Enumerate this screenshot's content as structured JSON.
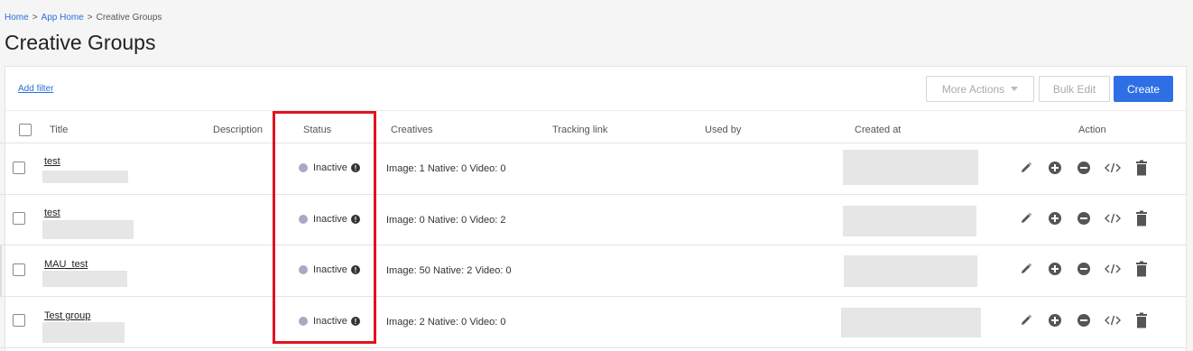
{
  "breadcrumb": {
    "items": [
      {
        "label": "Home",
        "link": true
      },
      {
        "label": "App Home",
        "link": true
      },
      {
        "label": "Creative Groups",
        "link": false
      }
    ],
    "separator": ">"
  },
  "page": {
    "title": "Creative Groups"
  },
  "toolbar": {
    "add_filter": "Add filter",
    "more_actions": "More Actions",
    "bulk_edit": "Bulk Edit",
    "create": "Create"
  },
  "table": {
    "columns": {
      "title": "Title",
      "description": "Description",
      "status": "Status",
      "creatives": "Creatives",
      "tracking_link": "Tracking link",
      "used_by": "Used by",
      "created_at": "Created at",
      "action": "Action"
    },
    "rows": [
      {
        "title": "test",
        "status": "Inactive",
        "creatives": "Image: 1 Native: 0 Video: 0"
      },
      {
        "title": "test",
        "status": "Inactive",
        "creatives": "Image: 0 Native: 0 Video: 2"
      },
      {
        "title": "MAU_test",
        "status": "Inactive",
        "creatives": "Image: 50 Native: 2 Video: 0"
      },
      {
        "title": "Test group",
        "status": "Inactive",
        "creatives": "Image: 2 Native: 0 Video: 0"
      }
    ]
  },
  "icons": {
    "edit": "pencil-icon",
    "add": "plus-circle-icon",
    "remove": "minus-circle-icon",
    "code": "code-icon",
    "delete": "trash-icon",
    "info": "info-icon"
  },
  "colors": {
    "accent": "#2f6fe6",
    "status_inactive": "#a7aac4",
    "highlight": "#e0141e",
    "link": "#2a6fdb"
  }
}
